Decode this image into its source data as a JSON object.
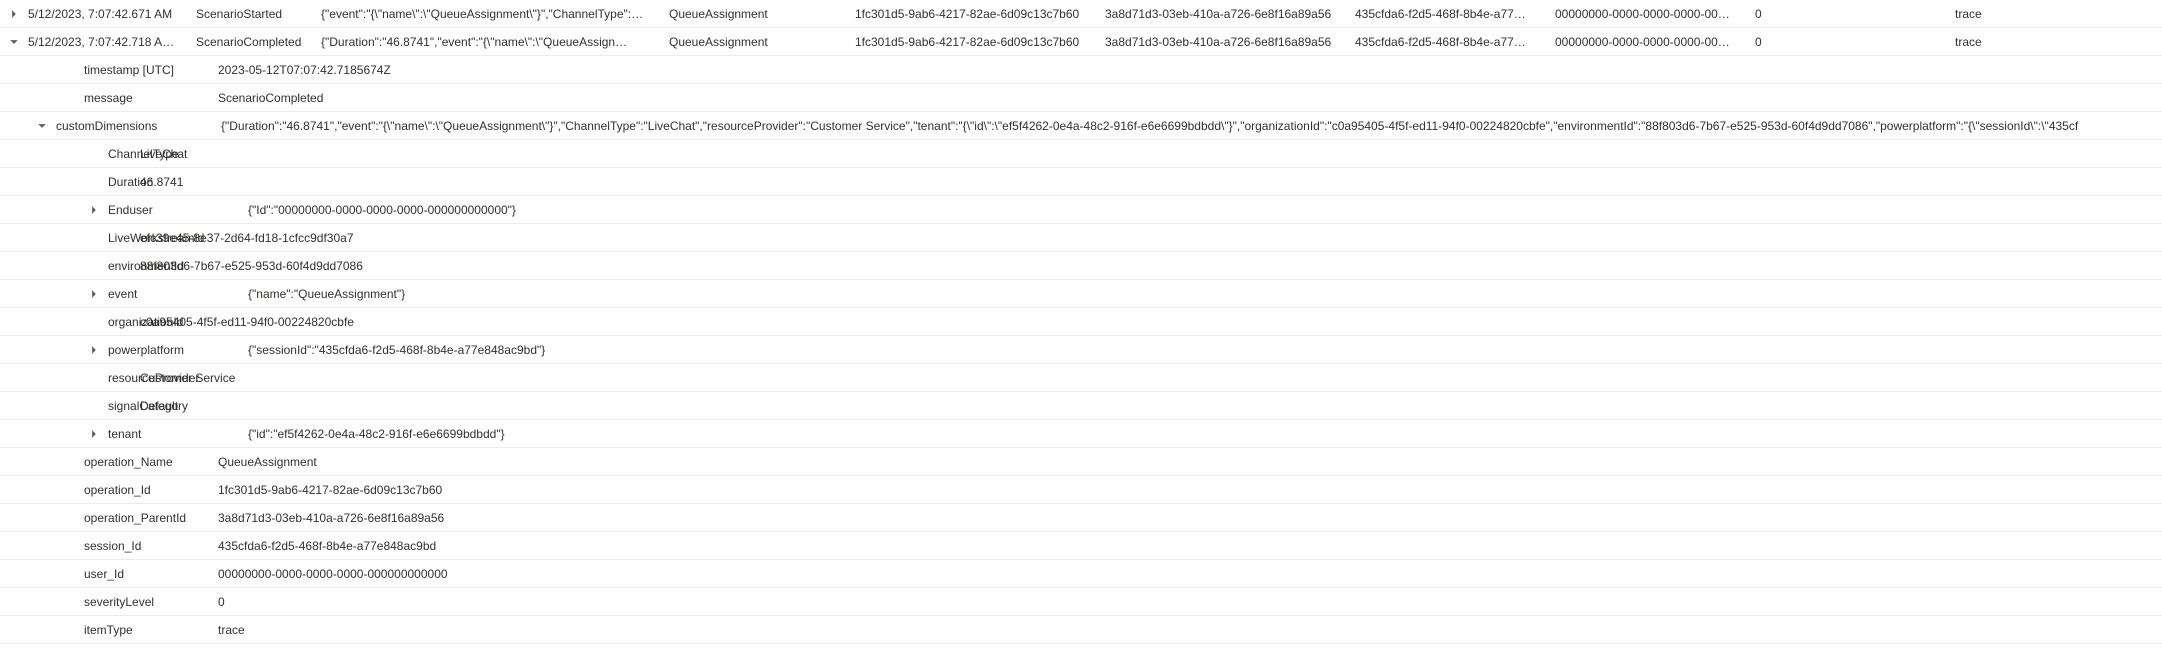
{
  "rows": [
    {
      "timestamp": "5/12/2023, 7:07:42.671 AM",
      "message": "ScenarioStarted",
      "dimensions": "{\"event\":\"{\\\"name\\\":\\\"QueueAssignment\\\"}\",\"ChannelType\":…",
      "opname": "QueueAssignment",
      "opid": "1fc301d5-9ab6-4217-82ae-6d09c13c7b60",
      "parentid": "3a8d71d3-03eb-410a-a726-6e8f16a89a56",
      "sessionid": "435cfda6-f2d5-468f-8b4e-a77…",
      "userid": "00000000-0000-0000-0000-00…",
      "severity": "0",
      "itemtype": "trace"
    },
    {
      "timestamp": "5/12/2023, 7:07:42.718 A…",
      "message": "ScenarioCompleted",
      "dimensions": "{\"Duration\":\"46.8741\",\"event\":\"{\\\"name\\\":\\\"QueueAssign…",
      "opname": "QueueAssignment",
      "opid": "1fc301d5-9ab6-4217-82ae-6d09c13c7b60",
      "parentid": "3a8d71d3-03eb-410a-a726-6e8f16a89a56",
      "sessionid": "435cfda6-f2d5-468f-8b4e-a77…",
      "userid": "00000000-0000-0000-0000-00…",
      "severity": "0",
      "itemtype": "trace"
    }
  ],
  "details": {
    "timestamp_label": "timestamp [UTC]",
    "timestamp_value": "2023-05-12T07:07:42.7185674Z",
    "message_label": "message",
    "message_value": "ScenarioCompleted",
    "customDimensions_label": "customDimensions",
    "customDimensions_value": "{\"Duration\":\"46.8741\",\"event\":\"{\\\"name\\\":\\\"QueueAssignment\\\"}\",\"ChannelType\":\"LiveChat\",\"resourceProvider\":\"Customer Service\",\"tenant\":\"{\\\"id\\\":\\\"ef5f4262-0e4a-48c2-916f-e6e6699bdbdd\\\"}\",\"organizationId\":\"c0a95405-4f5f-ed11-94f0-00224820cbfe\",\"environmentId\":\"88f803d6-7b67-e525-953d-60f4d9dd7086\",\"powerplatform\":\"{\\\"sessionId\\\":\\\"435cf",
    "dims": {
      "ChannelType_label": "ChannelType",
      "ChannelType_value": "LiveChat",
      "Duration_label": "Duration",
      "Duration_value": "46.8741",
      "Enduser_label": "Enduser",
      "Enduser_value": "{\"Id\":\"00000000-0000-0000-0000-000000000000\"}",
      "LiveWorkstreamId_label": "LiveWorkstreamId",
      "LiveWorkstreamId_value": "efc39e45-8e37-2d64-fd18-1cfcc9df30a7",
      "environmentId_label": "environmentId",
      "environmentId_value": "88f803d6-7b67-e525-953d-60f4d9dd7086",
      "event_label": "event",
      "event_value": "{\"name\":\"QueueAssignment\"}",
      "organizationId_label": "organizationId",
      "organizationId_value": "c0a95405-4f5f-ed11-94f0-00224820cbfe",
      "powerplatform_label": "powerplatform",
      "powerplatform_value": "{\"sessionId\":\"435cfda6-f2d5-468f-8b4e-a77e848ac9bd\"}",
      "resourceProvider_label": "resourceProvider",
      "resourceProvider_value": "Customer Service",
      "signalCategory_label": "signalCategory",
      "signalCategory_value": "Default",
      "tenant_label": "tenant",
      "tenant_value": "{\"id\":\"ef5f4262-0e4a-48c2-916f-e6e6699bdbdd\"}"
    },
    "operation_Name_label": "operation_Name",
    "operation_Name_value": "QueueAssignment",
    "operation_Id_label": "operation_Id",
    "operation_Id_value": "1fc301d5-9ab6-4217-82ae-6d09c13c7b60",
    "operation_ParentId_label": "operation_ParentId",
    "operation_ParentId_value": "3a8d71d3-03eb-410a-a726-6e8f16a89a56",
    "session_Id_label": "session_Id",
    "session_Id_value": "435cfda6-f2d5-468f-8b4e-a77e848ac9bd",
    "user_Id_label": "user_Id",
    "user_Id_value": "00000000-0000-0000-0000-000000000000",
    "severityLevel_label": "severityLevel",
    "severityLevel_value": "0",
    "itemType_label": "itemType",
    "itemType_value": "trace"
  }
}
